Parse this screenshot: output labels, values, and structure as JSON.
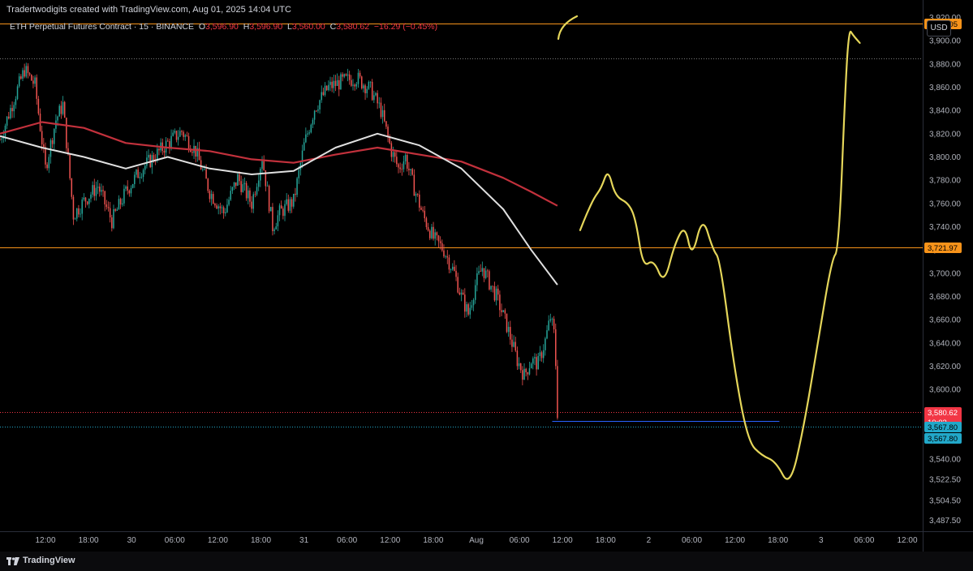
{
  "header": {
    "attribution": "Tradertwodigits created with TradingView.com, Aug 01, 2025 14:04 UTC",
    "symbol": "ETH Perpetual Futures Contract · 15 · BINANCE",
    "o_label": "O",
    "o_value": "3,596.90",
    "h_label": "H",
    "h_value": "3,596.90",
    "l_label": "L",
    "l_value": "3,560.00",
    "c_label": "C",
    "c_value": "3,580.62",
    "change": "−16.29 (−0.45%)",
    "currency": "USD"
  },
  "footer": {
    "brand": "TradingView"
  },
  "colors": {
    "up": "#26a69a",
    "down": "#ef5350",
    "ma_long": "#c2313c",
    "ma_mid": "#e0e0e0",
    "hline": "#f7931a",
    "last_price": "#f23645",
    "target": "#22a8c9",
    "drawing": "#e5d65a"
  },
  "chart_data": {
    "type": "candlestick",
    "symbol": "ETH Perpetual Futures Contract",
    "interval": "15",
    "exchange": "BINANCE",
    "ylim": [
      3478,
      3935
    ],
    "y_ticks": [
      3487.5,
      3504.5,
      3522.5,
      3540,
      3560,
      3580,
      3600,
      3620,
      3640,
      3660,
      3680,
      3700,
      3720,
      3740,
      3760,
      3780,
      3800,
      3820,
      3840,
      3860,
      3880,
      3900,
      3920
    ],
    "y_tick_labels": [
      "3,487.50",
      "3,504.50",
      "3,522.50",
      "3,540.00",
      "3,560.00",
      "3,580.00",
      "3,600.00",
      "3,620.00",
      "3,640.00",
      "3,660.00",
      "3,680.00",
      "3,700.00",
      "3,720.00",
      "3,740.00",
      "3,760.00",
      "3,780.00",
      "3,800.00",
      "3,820.00",
      "3,840.00",
      "3,860.00",
      "3,880.00",
      "3,900.00",
      "3,920.00"
    ],
    "x_ticks": [
      "12:00",
      "18:00",
      "30",
      "06:00",
      "12:00",
      "18:00",
      "31",
      "06:00",
      "12:00",
      "18:00",
      "Aug",
      "06:00",
      "12:00",
      "18:00",
      "2",
      "06:00",
      "12:00",
      "18:00",
      "3",
      "06:00",
      "12:00"
    ],
    "x_start": "2025-07-29 06:00",
    "x_end": "2025-08-03 18:00",
    "last_candle": "2025-08-01 13:45",
    "closes": [
      {
        "t": "2025-07-29 06:00",
        "v": 3815
      },
      {
        "t": "2025-07-29 08:00",
        "v": 3850
      },
      {
        "t": "2025-07-29 09:30",
        "v": 3875
      },
      {
        "t": "2025-07-29 11:00",
        "v": 3862
      },
      {
        "t": "2025-07-29 12:30",
        "v": 3790
      },
      {
        "t": "2025-07-29 14:00",
        "v": 3832
      },
      {
        "t": "2025-07-29 15:00",
        "v": 3845
      },
      {
        "t": "2025-07-29 16:30",
        "v": 3750
      },
      {
        "t": "2025-07-29 18:00",
        "v": 3762
      },
      {
        "t": "2025-07-29 20:00",
        "v": 3775
      },
      {
        "t": "2025-07-29 22:00",
        "v": 3745
      },
      {
        "t": "2025-07-30 00:00",
        "v": 3770
      },
      {
        "t": "2025-07-30 02:00",
        "v": 3788
      },
      {
        "t": "2025-07-30 04:00",
        "v": 3800
      },
      {
        "t": "2025-07-30 06:00",
        "v": 3812
      },
      {
        "t": "2025-07-30 08:00",
        "v": 3822
      },
      {
        "t": "2025-07-30 10:00",
        "v": 3805
      },
      {
        "t": "2025-07-30 12:00",
        "v": 3770
      },
      {
        "t": "2025-07-30 14:00",
        "v": 3752
      },
      {
        "t": "2025-07-30 16:00",
        "v": 3782
      },
      {
        "t": "2025-07-30 18:00",
        "v": 3760
      },
      {
        "t": "2025-07-30 19:30",
        "v": 3800
      },
      {
        "t": "2025-07-30 21:00",
        "v": 3740
      },
      {
        "t": "2025-07-30 22:00",
        "v": 3752
      },
      {
        "t": "2025-07-31 00:00",
        "v": 3762
      },
      {
        "t": "2025-07-31 01:30",
        "v": 3810
      },
      {
        "t": "2025-07-31 03:00",
        "v": 3842
      },
      {
        "t": "2025-07-31 05:00",
        "v": 3860
      },
      {
        "t": "2025-07-31 07:00",
        "v": 3865
      },
      {
        "t": "2025-07-31 09:00",
        "v": 3868
      },
      {
        "t": "2025-07-31 11:00",
        "v": 3858
      },
      {
        "t": "2025-07-31 12:30",
        "v": 3840
      },
      {
        "t": "2025-07-31 14:00",
        "v": 3805
      },
      {
        "t": "2025-07-31 15:00",
        "v": 3790
      },
      {
        "t": "2025-07-31 16:00",
        "v": 3800
      },
      {
        "t": "2025-07-31 17:00",
        "v": 3778
      },
      {
        "t": "2025-07-31 18:30",
        "v": 3750
      },
      {
        "t": "2025-07-31 20:00",
        "v": 3730
      },
      {
        "t": "2025-07-31 21:30",
        "v": 3720
      },
      {
        "t": "2025-07-31 23:00",
        "v": 3700
      },
      {
        "t": "2025-08-01 00:00",
        "v": 3680
      },
      {
        "t": "2025-08-01 01:00",
        "v": 3665
      },
      {
        "t": "2025-08-01 02:00",
        "v": 3690
      },
      {
        "t": "2025-08-01 03:00",
        "v": 3705
      },
      {
        "t": "2025-08-01 04:00",
        "v": 3692
      },
      {
        "t": "2025-08-01 05:00",
        "v": 3680
      },
      {
        "t": "2025-08-01 06:30",
        "v": 3655
      },
      {
        "t": "2025-08-01 08:00",
        "v": 3625
      },
      {
        "t": "2025-08-01 09:00",
        "v": 3612
      },
      {
        "t": "2025-08-01 10:00",
        "v": 3625
      },
      {
        "t": "2025-08-01 11:00",
        "v": 3622
      },
      {
        "t": "2025-08-01 12:00",
        "v": 3642
      },
      {
        "t": "2025-08-01 12:45",
        "v": 3662
      },
      {
        "t": "2025-08-01 13:15",
        "v": 3648
      },
      {
        "t": "2025-08-01 13:30",
        "v": 3622
      },
      {
        "t": "2025-08-01 13:45",
        "v": 3580.62
      }
    ],
    "ma_long": [
      {
        "t": "2025-07-29 06:00",
        "v": 3820
      },
      {
        "t": "2025-07-29 12:00",
        "v": 3830
      },
      {
        "t": "2025-07-29 18:00",
        "v": 3825
      },
      {
        "t": "2025-07-30 00:00",
        "v": 3812
      },
      {
        "t": "2025-07-30 06:00",
        "v": 3808
      },
      {
        "t": "2025-07-30 12:00",
        "v": 3805
      },
      {
        "t": "2025-07-30 18:00",
        "v": 3798
      },
      {
        "t": "2025-07-31 00:00",
        "v": 3795
      },
      {
        "t": "2025-07-31 06:00",
        "v": 3802
      },
      {
        "t": "2025-07-31 12:00",
        "v": 3808
      },
      {
        "t": "2025-07-31 18:00",
        "v": 3802
      },
      {
        "t": "2025-08-01 00:00",
        "v": 3796
      },
      {
        "t": "2025-08-01 06:00",
        "v": 3782
      },
      {
        "t": "2025-08-01 10:00",
        "v": 3770
      },
      {
        "t": "2025-08-01 13:45",
        "v": 3758
      }
    ],
    "ma_mid": [
      {
        "t": "2025-07-29 06:00",
        "v": 3818
      },
      {
        "t": "2025-07-29 12:00",
        "v": 3808
      },
      {
        "t": "2025-07-29 18:00",
        "v": 3800
      },
      {
        "t": "2025-07-30 00:00",
        "v": 3790
      },
      {
        "t": "2025-07-30 06:00",
        "v": 3800
      },
      {
        "t": "2025-07-30 12:00",
        "v": 3790
      },
      {
        "t": "2025-07-30 18:00",
        "v": 3785
      },
      {
        "t": "2025-07-31 00:00",
        "v": 3788
      },
      {
        "t": "2025-07-31 06:00",
        "v": 3808
      },
      {
        "t": "2025-07-31 12:00",
        "v": 3820
      },
      {
        "t": "2025-07-31 18:00",
        "v": 3810
      },
      {
        "t": "2025-08-01 00:00",
        "v": 3790
      },
      {
        "t": "2025-08-01 06:00",
        "v": 3755
      },
      {
        "t": "2025-08-01 10:00",
        "v": 3720
      },
      {
        "t": "2025-08-01 13:45",
        "v": 3690
      }
    ],
    "horizontal_lines": [
      {
        "price": 3915.05,
        "label": "3,915.05",
        "color": "#f7931a",
        "style": "solid"
      },
      {
        "price": 3885,
        "label": "",
        "color": "#7a7a7a",
        "style": "dotted"
      },
      {
        "price": 3721.97,
        "label": "3,721.97",
        "color": "#f7931a",
        "style": "solid"
      },
      {
        "price": 3580.62,
        "label": "3,580.62",
        "color": "#f23645",
        "style": "dotted",
        "countdown": "10:03"
      },
      {
        "price": 3567.8,
        "label": "3,567.80",
        "color": "#22a8c9",
        "style": "dotted",
        "second_label": "3,567.80"
      }
    ],
    "target_segment": {
      "price": 3573,
      "from": "2025-08-01 13:00",
      "to": "2025-08-02 21:30",
      "color": "#2962ff"
    },
    "projection_path": [
      {
        "t": "2025-08-01 17:00",
        "v": 3737
      },
      {
        "t": "2025-08-01 18:00",
        "v": 3752
      },
      {
        "t": "2025-08-01 19:00",
        "v": 3765
      },
      {
        "t": "2025-08-01 20:00",
        "v": 3773
      },
      {
        "t": "2025-08-01 21:00",
        "v": 3790
      },
      {
        "t": "2025-08-01 22:00",
        "v": 3766
      },
      {
        "t": "2025-08-02 00:00",
        "v": 3760
      },
      {
        "t": "2025-08-02 01:00",
        "v": 3745
      },
      {
        "t": "2025-08-02 02:00",
        "v": 3705
      },
      {
        "t": "2025-08-02 03:30",
        "v": 3712
      },
      {
        "t": "2025-08-02 05:00",
        "v": 3690
      },
      {
        "t": "2025-08-02 06:30",
        "v": 3725
      },
      {
        "t": "2025-08-02 08:00",
        "v": 3742
      },
      {
        "t": "2025-08-02 09:00",
        "v": 3712
      },
      {
        "t": "2025-08-02 10:30",
        "v": 3750
      },
      {
        "t": "2025-08-02 12:00",
        "v": 3720
      },
      {
        "t": "2025-08-02 13:00",
        "v": 3712
      },
      {
        "t": "2025-08-02 15:00",
        "v": 3620
      },
      {
        "t": "2025-08-02 17:00",
        "v": 3555
      },
      {
        "t": "2025-08-02 19:00",
        "v": 3543
      },
      {
        "t": "2025-08-02 21:00",
        "v": 3538
      },
      {
        "t": "2025-08-02 23:00",
        "v": 3515
      },
      {
        "t": "2025-08-03 01:00",
        "v": 3568
      },
      {
        "t": "2025-08-03 03:00",
        "v": 3640
      },
      {
        "t": "2025-08-03 05:00",
        "v": 3712
      },
      {
        "t": "2025-08-03 06:00",
        "v": 3720
      },
      {
        "t": "2025-08-03 07:00",
        "v": 3870
      },
      {
        "t": "2025-08-03 07:30",
        "v": 3910
      },
      {
        "t": "2025-08-03 08:00",
        "v": 3905
      },
      {
        "t": "2025-08-03 09:00",
        "v": 3898
      }
    ]
  }
}
